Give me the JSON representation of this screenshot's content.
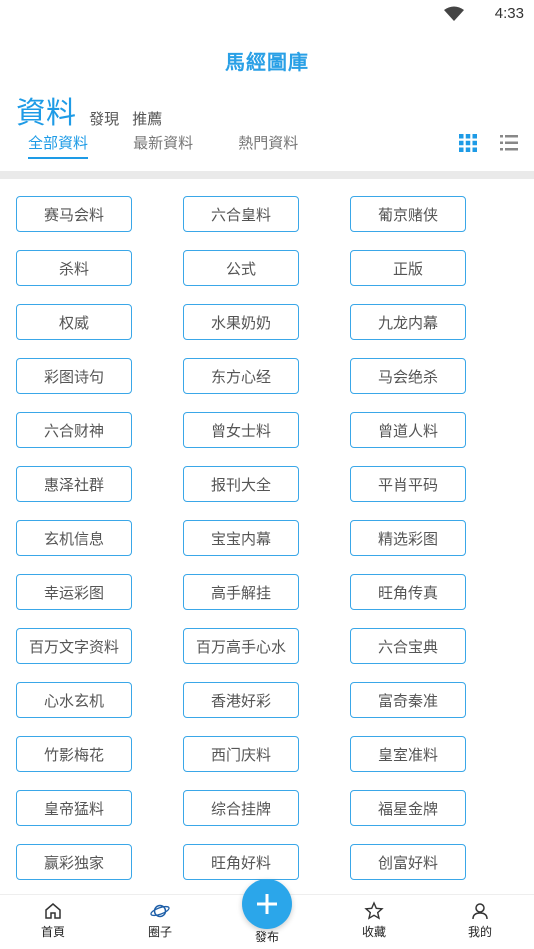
{
  "status": {
    "time": "4:33"
  },
  "app_title": "馬經圖庫",
  "header": {
    "title": "資料",
    "links": [
      "發現",
      "推薦"
    ]
  },
  "tabs": [
    {
      "label": "全部資料",
      "active": true
    },
    {
      "label": "最新資料",
      "active": false
    },
    {
      "label": "熱門資料",
      "active": false
    }
  ],
  "categories": [
    "赛马会料",
    "六合皇料",
    "葡京赌侠",
    "杀料",
    "公式",
    "正版",
    "权威",
    "水果奶奶",
    "九龙内幕",
    "彩图诗句",
    "东方心经",
    "马会绝杀",
    "六合财神",
    "曾女士料",
    "曾道人料",
    "惠泽社群",
    "报刊大全",
    "平肖平码",
    "玄机信息",
    "宝宝内幕",
    "精选彩图",
    "幸运彩图",
    "高手解挂",
    "旺角传真",
    "百万文字资料",
    "百万高手心水",
    "六合宝典",
    "心水玄机",
    "香港好彩",
    "富奇秦准",
    "竹影梅花",
    "西门庆料",
    "皇室准料",
    "皇帝猛料",
    "综合挂牌",
    "福星金牌",
    "赢彩独家",
    "旺角好料",
    "创富好料"
  ],
  "bottom_nav": {
    "home": "首頁",
    "circle": "圈子",
    "publish": "發布",
    "favorites": "收藏",
    "mine": "我的"
  },
  "colors": {
    "accent": "#1e9be6",
    "border": "#3aa7e8"
  }
}
